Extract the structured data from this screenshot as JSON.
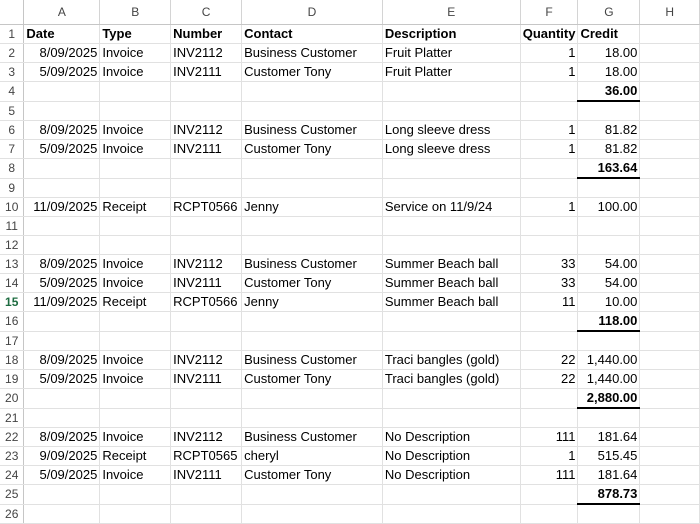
{
  "columns": [
    "A",
    "B",
    "C",
    "D",
    "E",
    "F",
    "G",
    "H"
  ],
  "rows": [
    {
      "n": "1",
      "cells": [
        "Date",
        "Type",
        "Number",
        "Contact",
        "Description",
        "Quantity",
        "Credit",
        ""
      ],
      "bold": true
    },
    {
      "n": "2",
      "cells": [
        "8/09/2025",
        "Invoice",
        "INV2112",
        "Business Customer",
        "Fruit Platter",
        "1",
        "18.00",
        ""
      ]
    },
    {
      "n": "3",
      "cells": [
        "5/09/2025",
        "Invoice",
        "INV2111",
        "Customer Tony",
        "Fruit Platter",
        "1",
        "18.00",
        ""
      ]
    },
    {
      "n": "4",
      "cells": [
        "",
        "",
        "",
        "",
        "",
        "",
        "36.00",
        ""
      ],
      "total": true
    },
    {
      "n": "5",
      "cells": [
        "",
        "",
        "",
        "",
        "",
        "",
        "",
        ""
      ]
    },
    {
      "n": "6",
      "cells": [
        "8/09/2025",
        "Invoice",
        "INV2112",
        "Business Customer",
        "Long sleeve dress",
        "1",
        "81.82",
        ""
      ]
    },
    {
      "n": "7",
      "cells": [
        "5/09/2025",
        "Invoice",
        "INV2111",
        "Customer Tony",
        "Long sleeve dress",
        "1",
        "81.82",
        ""
      ]
    },
    {
      "n": "8",
      "cells": [
        "",
        "",
        "",
        "",
        "",
        "",
        "163.64",
        ""
      ],
      "total": true
    },
    {
      "n": "9",
      "cells": [
        "",
        "",
        "",
        "",
        "",
        "",
        "",
        ""
      ]
    },
    {
      "n": "10",
      "cells": [
        "11/09/2025",
        "Receipt",
        "RCPT0566",
        "Jenny",
        "Service on 11/9/24",
        "1",
        "100.00",
        ""
      ]
    },
    {
      "n": "11",
      "cells": [
        "",
        "",
        "",
        "",
        "",
        "",
        "",
        ""
      ]
    },
    {
      "n": "12",
      "cells": [
        "",
        "",
        "",
        "",
        "",
        "",
        "",
        ""
      ]
    },
    {
      "n": "13",
      "cells": [
        "8/09/2025",
        "Invoice",
        "INV2112",
        "Business Customer",
        "Summer Beach ball",
        "33",
        "54.00",
        ""
      ]
    },
    {
      "n": "14",
      "cells": [
        "5/09/2025",
        "Invoice",
        "INV2111",
        "Customer Tony",
        "Summer Beach ball",
        "33",
        "54.00",
        ""
      ]
    },
    {
      "n": "15",
      "cells": [
        "11/09/2025",
        "Receipt",
        "RCPT0566",
        "Jenny",
        "Summer Beach ball",
        "11",
        "10.00",
        ""
      ],
      "selected": true
    },
    {
      "n": "16",
      "cells": [
        "",
        "",
        "",
        "",
        "",
        "",
        "118.00",
        ""
      ],
      "total": true
    },
    {
      "n": "17",
      "cells": [
        "",
        "",
        "",
        "",
        "",
        "",
        "",
        ""
      ]
    },
    {
      "n": "18",
      "cells": [
        "8/09/2025",
        "Invoice",
        "INV2112",
        "Business Customer",
        "Traci bangles (gold)",
        "22",
        "1,440.00",
        ""
      ]
    },
    {
      "n": "19",
      "cells": [
        "5/09/2025",
        "Invoice",
        "INV2111",
        "Customer Tony",
        "Traci bangles (gold)",
        "22",
        "1,440.00",
        ""
      ]
    },
    {
      "n": "20",
      "cells": [
        "",
        "",
        "",
        "",
        "",
        "",
        "2,880.00",
        ""
      ],
      "total": true
    },
    {
      "n": "21",
      "cells": [
        "",
        "",
        "",
        "",
        "",
        "",
        "",
        ""
      ]
    },
    {
      "n": "22",
      "cells": [
        "8/09/2025",
        "Invoice",
        "INV2112",
        "Business Customer",
        "No Description",
        "111",
        "181.64",
        ""
      ]
    },
    {
      "n": "23",
      "cells": [
        "9/09/2025",
        "Receipt",
        "RCPT0565",
        "cheryl",
        "No Description",
        "1",
        "515.45",
        ""
      ]
    },
    {
      "n": "24",
      "cells": [
        "5/09/2025",
        "Invoice",
        "INV2111",
        "Customer Tony",
        "No Description",
        "111",
        "181.64",
        ""
      ]
    },
    {
      "n": "25",
      "cells": [
        "",
        "",
        "",
        "",
        "",
        "",
        "878.73",
        ""
      ],
      "total": true
    },
    {
      "n": "26",
      "cells": [
        "",
        "",
        "",
        "",
        "",
        "",
        "",
        ""
      ]
    }
  ]
}
